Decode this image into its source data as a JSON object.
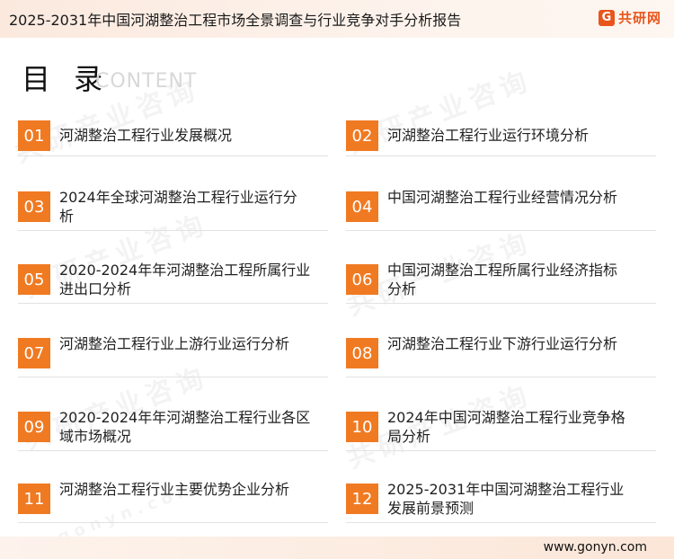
{
  "header": {
    "title": "2025-2031年中国河湖整治工程市场全景调查与行业竞争对手分析报告",
    "logo_mark": "G",
    "logo_text": "共研网"
  },
  "toc": {
    "heading": "目 录",
    "subheading": "CONTENT",
    "items": [
      {
        "num": "01",
        "label": "河湖整治工程行业发展概况"
      },
      {
        "num": "02",
        "label": "河湖整治工程行业运行环境分析"
      },
      {
        "num": "03",
        "label": "2024年全球河湖整治工程行业运行分析"
      },
      {
        "num": "04",
        "label": "中国河湖整治工程行业经营情况分析"
      },
      {
        "num": "05",
        "label": "2020-2024年年河湖整治工程所属行业进出口分析"
      },
      {
        "num": "06",
        "label": "中国河湖整治工程所属行业经济指标分析"
      },
      {
        "num": "07",
        "label": "河湖整治工程行业上游行业运行分析"
      },
      {
        "num": "08",
        "label": "河湖整治工程行业下游行业运行分析"
      },
      {
        "num": "09",
        "label": "2020-2024年年河湖整治工程行业各区域市场概况"
      },
      {
        "num": "10",
        "label": "2024年中国河湖整治工程行业竞争格局分析"
      },
      {
        "num": "11",
        "label": "河湖整治工程行业主要优势企业分析"
      },
      {
        "num": "12",
        "label": "2025-2031年中国河湖整治工程行业发展前景预测"
      }
    ]
  },
  "watermark": {
    "cn": "共研产业咨询",
    "en": "gonyn.com"
  },
  "footer": {
    "url": "www.gonyn.com"
  },
  "colors": {
    "accent": "#f07a22",
    "brand": "#e8561c"
  }
}
